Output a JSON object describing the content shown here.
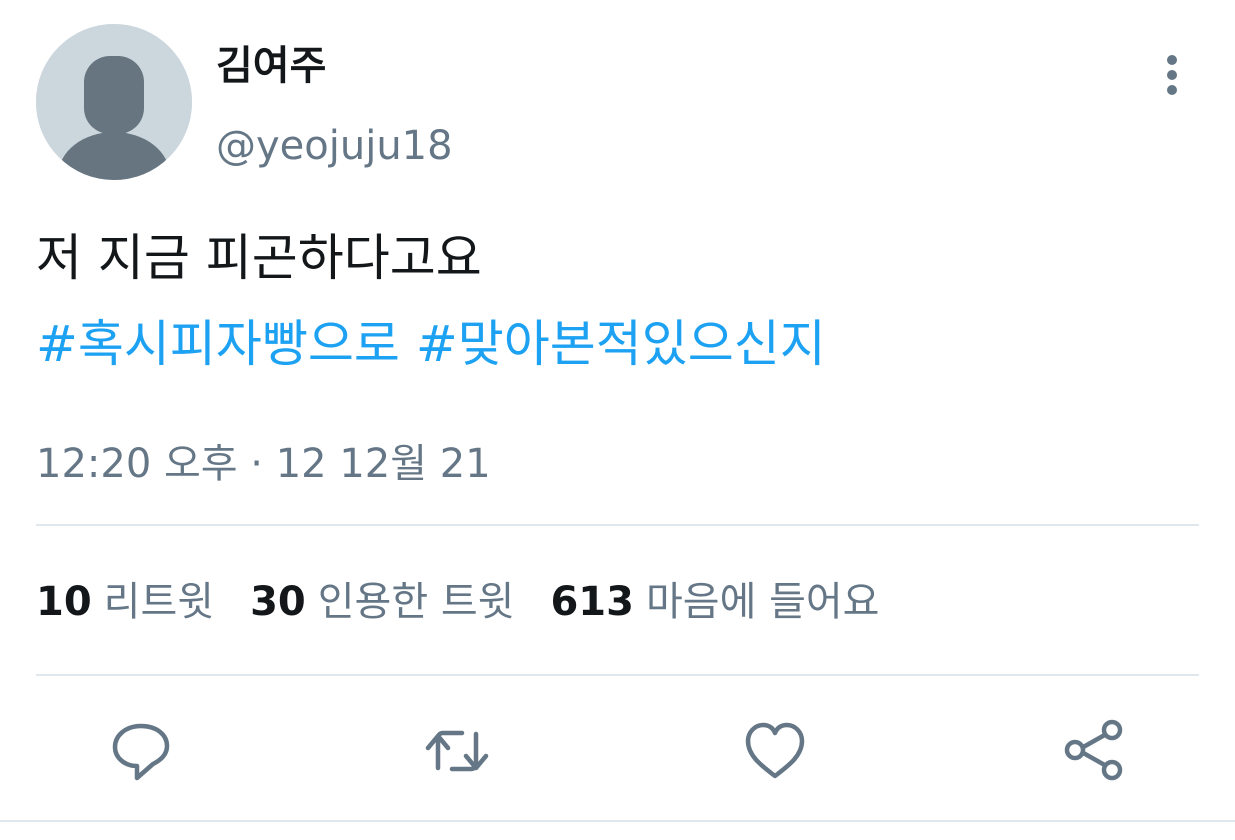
{
  "author": {
    "display_name": "김여주",
    "handle": "@yeojuju18"
  },
  "tweet": {
    "text": "저 지금 피곤하다고요",
    "hashtags": [
      "#혹시피자빵으로",
      "#맞아본적있으신지"
    ],
    "timestamp": "12:20 오후 · 12 12월 21"
  },
  "stats": {
    "retweets": {
      "count": "10",
      "label": "리트윗"
    },
    "quotes": {
      "count": "30",
      "label": "인용한 트윗"
    },
    "likes": {
      "count": "613",
      "label": "마음에 들어요"
    }
  },
  "actions": {
    "reply_icon": "reply-icon",
    "retweet_icon": "retweet-icon",
    "like_icon": "heart-icon",
    "share_icon": "share-icon"
  },
  "colors": {
    "hashtag": "#1da1f2",
    "secondary_text": "#657786",
    "primary_text": "#14171a",
    "divider": "#e1e8ed",
    "avatar_bg": "#ccd6dd",
    "avatar_fg": "#66757f"
  }
}
